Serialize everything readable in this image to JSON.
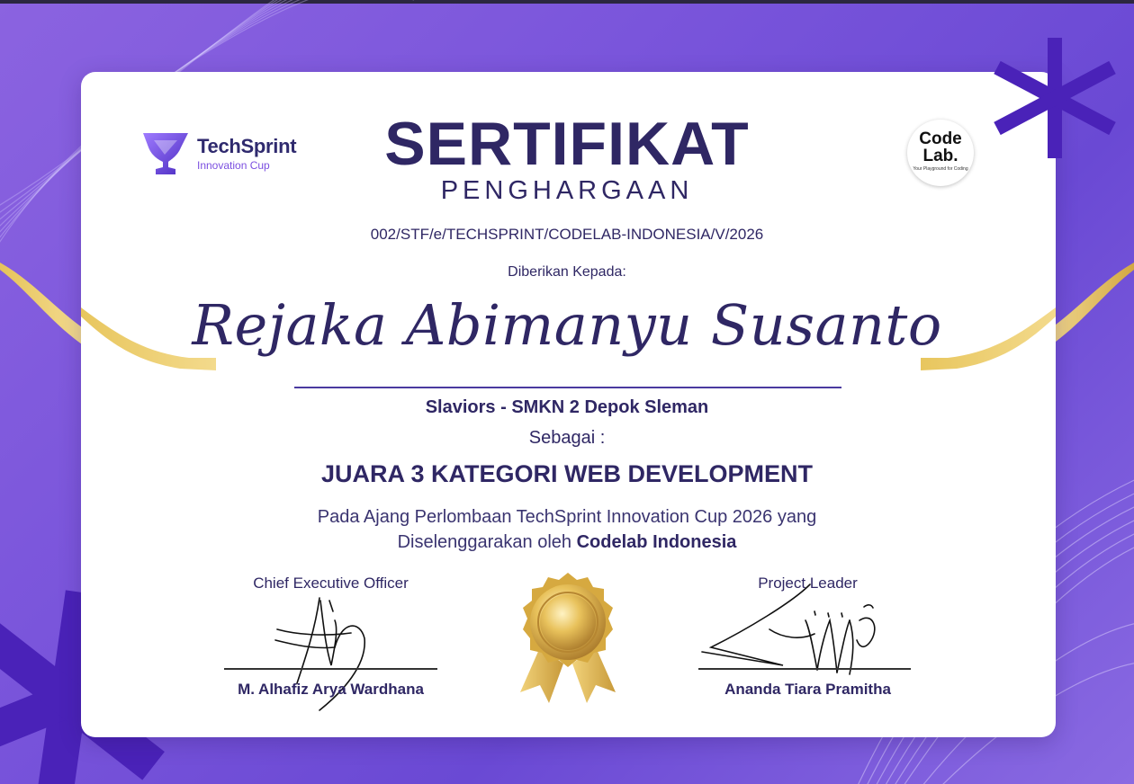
{
  "colors": {
    "accent": "#2f2764",
    "brand_purple": "#7b4fe0",
    "gold": "#d9b44a",
    "background": "#7a55db"
  },
  "logos": {
    "left": {
      "name": "TechSprint",
      "subtitle": "Innovation Cup",
      "icon": "trophy-icon"
    },
    "right": {
      "line1": "Code",
      "line2": "Lab.",
      "tagline": "Your Playground for Coding"
    }
  },
  "certificate": {
    "title": "SERTIFIKAT",
    "subtitle": "PENGHARGAAN",
    "number": "002/STF/e/TECHSPRINT/CODELAB-INDONESIA/V/2026",
    "given_to_label": "Diberikan Kepada:",
    "recipient": "Rejaka Abimanyu Susanto",
    "team": "Slaviors - SMKN 2 Depok Sleman",
    "as_label": "Sebagai :",
    "award": "JUARA 3 KATEGORI WEB DEVELOPMENT",
    "event_line1": "Pada Ajang Perlombaan TechSprint Innovation Cup 2026 yang",
    "event_line2_prefix": "Diselenggarakan oleh",
    "event_line2_org": "Codelab Indonesia"
  },
  "signatures": [
    {
      "role": "Chief Executive Officer",
      "name": "M. Alhafiz Arya Wardhana"
    },
    {
      "role": "Project Leader",
      "name": "Ananda Tiara Pramitha"
    }
  ],
  "seal": {
    "icon": "gold-medal-icon"
  }
}
